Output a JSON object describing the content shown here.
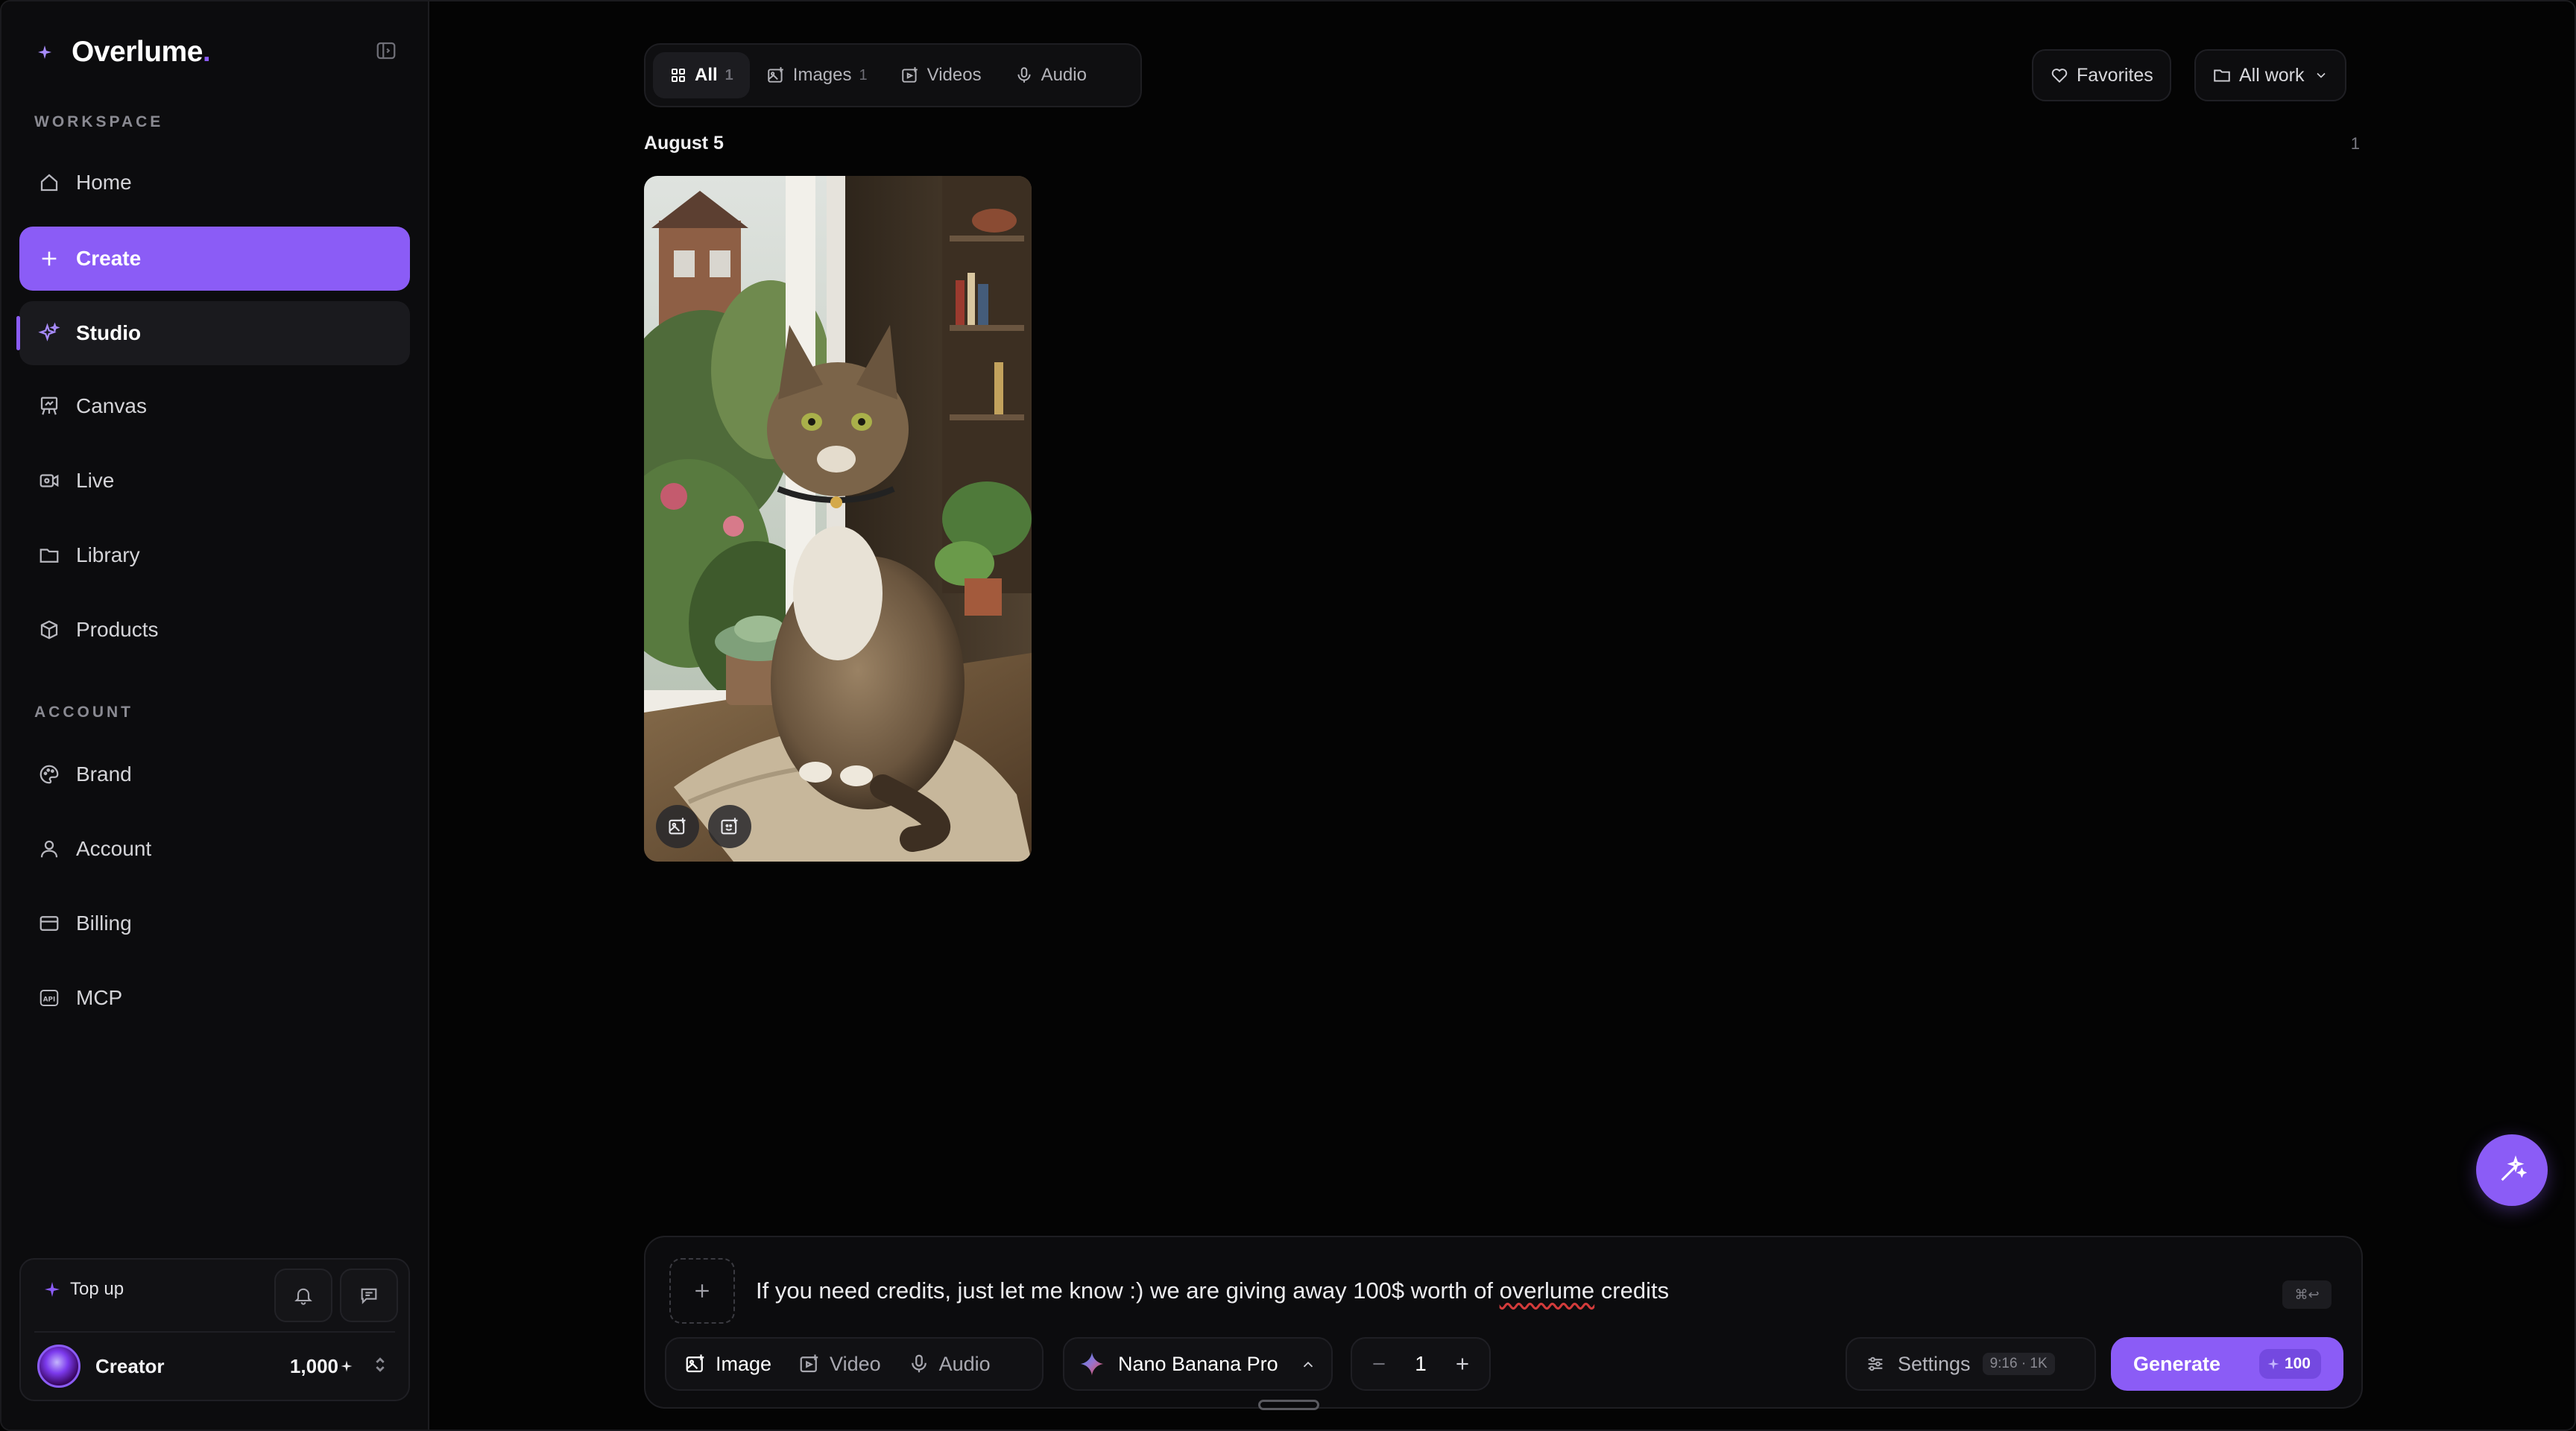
{
  "brand": {
    "name": "Overlume",
    "dot": ".",
    "accent": "#8b5cf6"
  },
  "sidebar": {
    "workspace_label": "WORKSPACE",
    "workspace_items": [
      {
        "label": "Home",
        "icon": "home-icon"
      },
      {
        "label": "Create",
        "icon": "plus-icon"
      },
      {
        "label": "Studio",
        "icon": "sparkle-icon"
      },
      {
        "label": "Canvas",
        "icon": "easel-icon"
      },
      {
        "label": "Live",
        "icon": "live-icon"
      },
      {
        "label": "Library",
        "icon": "folder-icon"
      },
      {
        "label": "Products",
        "icon": "box-icon"
      }
    ],
    "account_label": "ACCOUNT",
    "account_items": [
      {
        "label": "Brand",
        "icon": "palette-icon"
      },
      {
        "label": "Account",
        "icon": "user-icon"
      },
      {
        "label": "Billing",
        "icon": "card-icon"
      },
      {
        "label": "MCP",
        "icon": "api-icon"
      }
    ],
    "active_item": "Studio",
    "topup_label": "Top up",
    "plan_name": "Creator",
    "credits": "1,000"
  },
  "filters": {
    "tabs": [
      {
        "label": "All",
        "count": "1",
        "icon": "grid-icon"
      },
      {
        "label": "Images",
        "count": "1",
        "icon": "image-icon"
      },
      {
        "label": "Videos",
        "count": "",
        "icon": "video-icon"
      },
      {
        "label": "Audio",
        "count": "",
        "icon": "mic-icon"
      }
    ],
    "active_tab": "All",
    "favorites_label": "Favorites",
    "scope_label": "All work"
  },
  "gallery": {
    "groups": [
      {
        "date": "August 5",
        "count": "1",
        "items": [
          {
            "kind": "image",
            "subject": "tabby cat sitting on windowsill"
          }
        ]
      }
    ]
  },
  "composer": {
    "prompt_before": "If you need credits, just let me know :) we are giving away 100$ worth of ",
    "prompt_misspelled": "overlume",
    "prompt_after": " credits",
    "shortcut_hint": "⌘↩",
    "modes": [
      {
        "label": "Image",
        "icon": "image-icon"
      },
      {
        "label": "Video",
        "icon": "video-icon"
      },
      {
        "label": "Audio",
        "icon": "mic-icon"
      }
    ],
    "active_mode": "Image",
    "model": "Nano Banana Pro",
    "quantity": "1",
    "settings_label": "Settings",
    "settings_tag": "9:16 · 1K",
    "generate_label": "Generate",
    "generate_cost": "100"
  }
}
